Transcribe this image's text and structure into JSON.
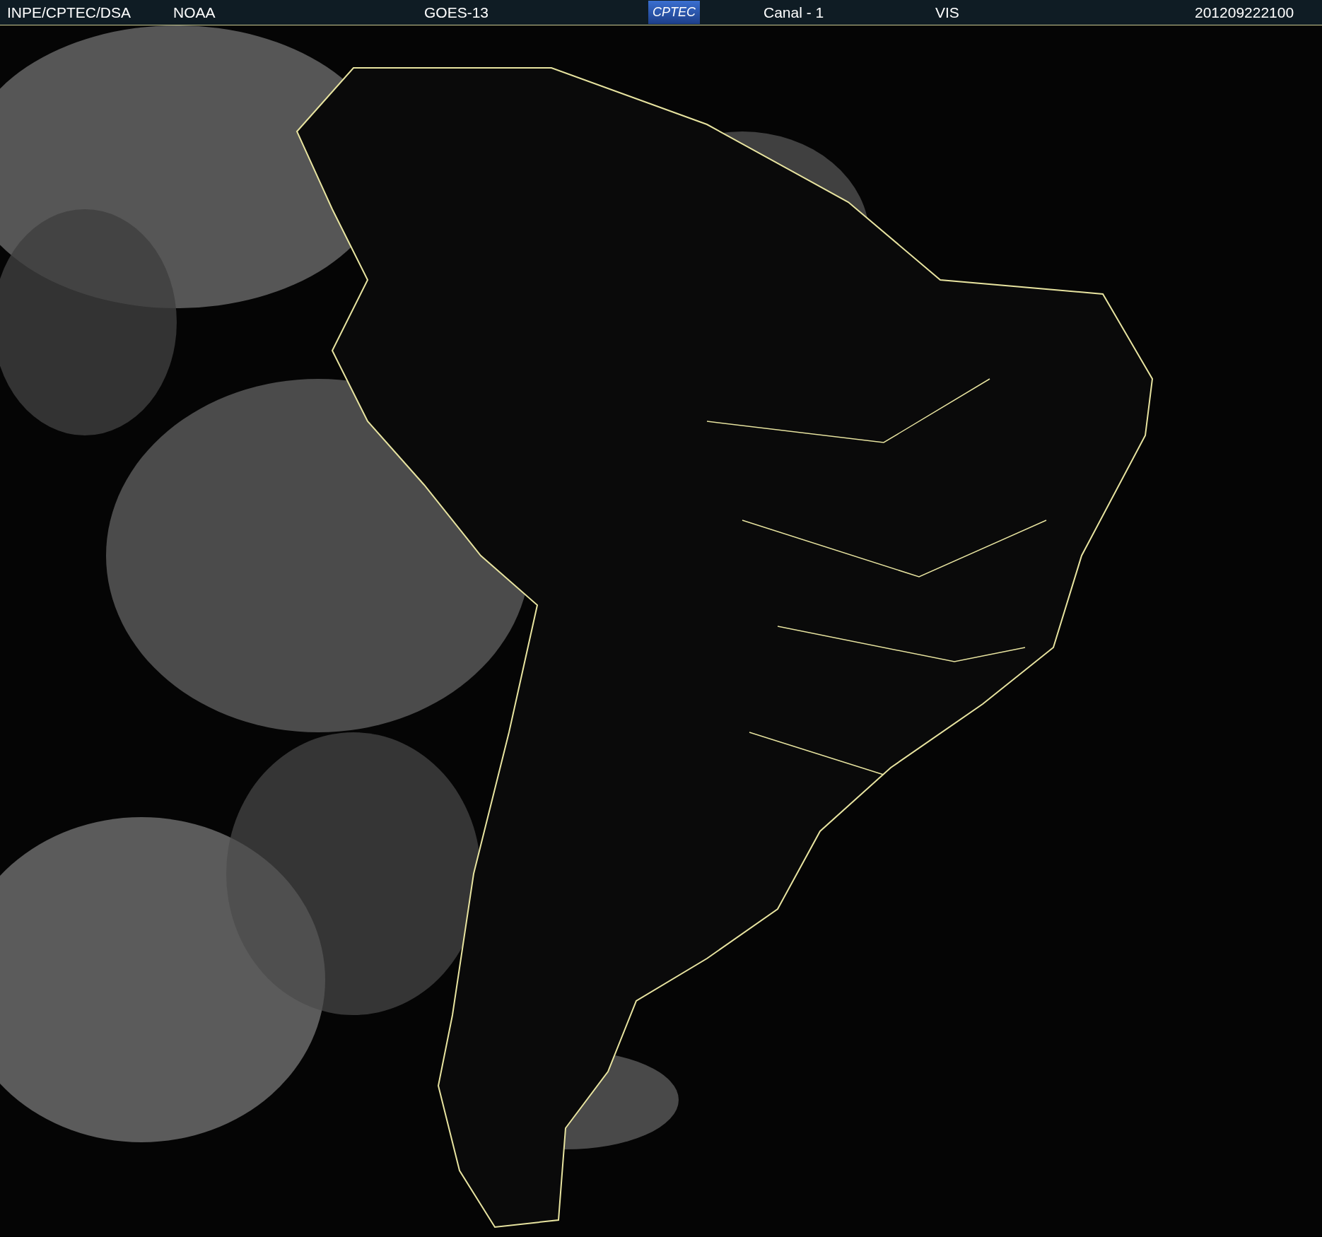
{
  "header": {
    "source": "INPE/CPTEC/DSA",
    "agency": "NOAA",
    "satellite": "GOES-13",
    "logo": "CPTEC",
    "channel": "Canal - 1",
    "band": "VIS",
    "timestamp": "201209222100"
  }
}
